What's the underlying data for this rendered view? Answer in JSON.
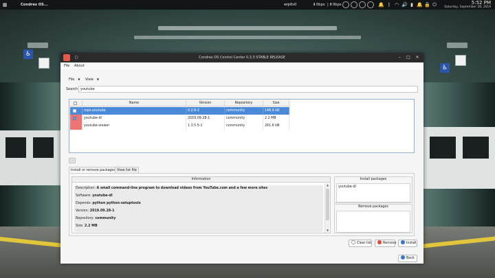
{
  "topbar": {
    "app_name": "Condres OS...",
    "network": "wlp6s0",
    "down_rate": "0bps",
    "up_rate": "0bps",
    "time": "5:52 PM",
    "date": "Saturday, September 28, 2019",
    "icons": [
      "download-arrow-icon",
      "upload-arrow-icon",
      "gauge-circle-icon",
      "gauge-circle-icon",
      "gauge-circle-icon",
      "gauge-circle-icon",
      "bell-icon",
      "bluetooth-icon",
      "wifi-icon",
      "volume-icon",
      "battery-icon",
      "bell-icon",
      "lock-icon",
      "power-icon"
    ]
  },
  "window": {
    "title": "Condres OS Control Center 0.3.3 STABLE RELEASE",
    "menu": {
      "file": "File",
      "about": "About"
    },
    "toolbar": {
      "file": "File",
      "view": "View"
    },
    "search": {
      "label": "Search",
      "value": "youtube"
    },
    "table": {
      "headers": [
        "Name",
        "Version",
        "Repository",
        "Size"
      ],
      "rows": [
        {
          "name": "mps-youtube",
          "version": "0.2.8-2",
          "repository": "community",
          "size": "146.9 kB",
          "selected": true,
          "installed": false
        },
        {
          "name": "youtube-dl",
          "version": "2019.09.28-1",
          "repository": "community",
          "size": "2.2 MB",
          "selected": false,
          "installed": true
        },
        {
          "name": "youtube-viewer",
          "version": "1.3.5.5-1",
          "repository": "community",
          "size": "261.6 kB",
          "selected": false,
          "installed": true
        }
      ]
    },
    "tabs": {
      "install_remove": "Install or remove packages",
      "view_list": "View list file"
    },
    "info": {
      "header": "Information",
      "lines": [
        {
          "label": "Description: ",
          "value": "A small command-line program to download videos from YouTube.com and a few more sites"
        },
        {
          "label": "Software: ",
          "value": "youtube-dl"
        },
        {
          "label": "Depends: ",
          "value": "python python-setuptools"
        },
        {
          "label": "Version: ",
          "value": "2019.09.28-1"
        },
        {
          "label": "Repository: ",
          "value": "community"
        },
        {
          "label": "Size: ",
          "value": "2.2 MB"
        }
      ]
    },
    "install_packages": {
      "header": "Install packages",
      "items": [
        "youtube-dl"
      ]
    },
    "remove_packages": {
      "header": "Remove packages",
      "items": []
    },
    "buttons": {
      "clear_list": "Clear list",
      "remove": "Remove",
      "install": "Install",
      "back": "Back"
    },
    "colors": {
      "selection": "#4a8ad8",
      "installed_marker": "#ef7575",
      "titlebar": "#2b2b2b"
    }
  }
}
